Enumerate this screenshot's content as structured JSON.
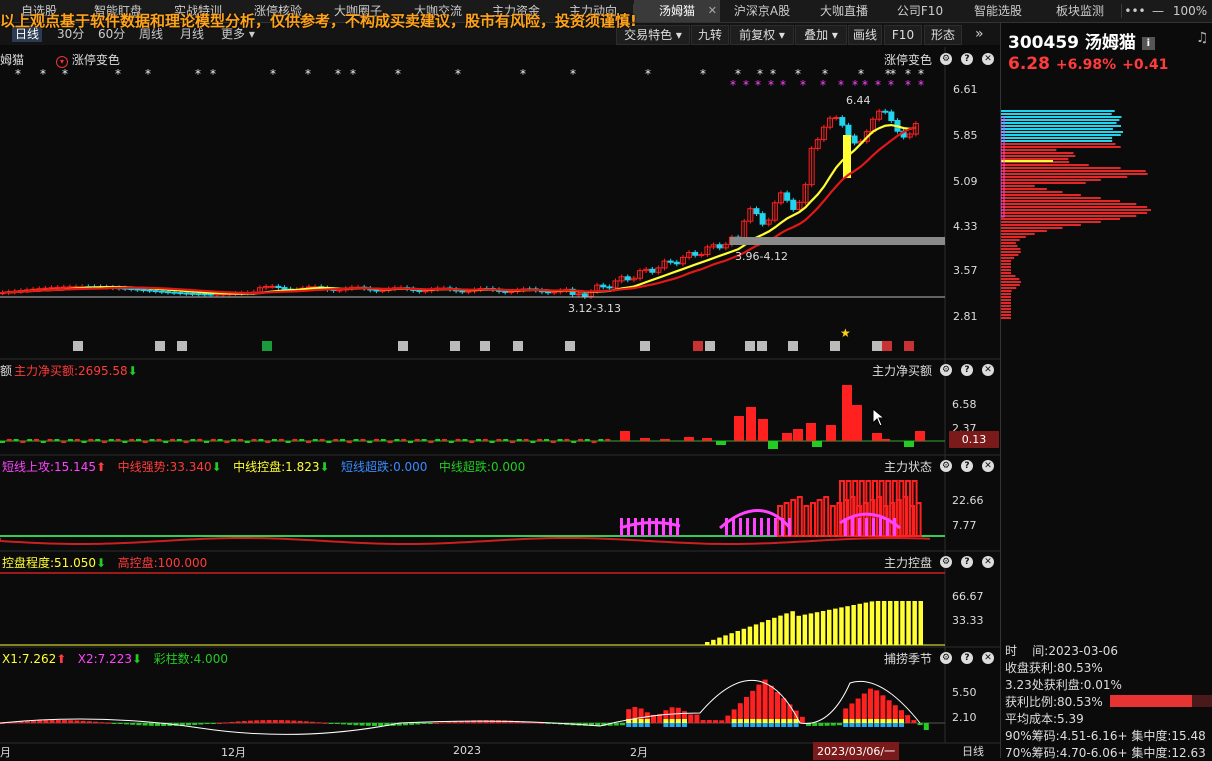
{
  "tabs": [
    {
      "label": "自选股"
    },
    {
      "label": "智能盯盘"
    },
    {
      "label": "实战特训"
    },
    {
      "label": "涨停核验"
    },
    {
      "label": "大咖圈子"
    },
    {
      "label": "大咖交流"
    },
    {
      "label": "主力资金"
    },
    {
      "label": "主力动向"
    },
    {
      "label": "汤姆猫"
    },
    {
      "label": "沪深京A股"
    },
    {
      "label": "大咖直播"
    },
    {
      "label": "公司F10"
    },
    {
      "label": "智能选股"
    },
    {
      "label": "板块监测"
    }
  ],
  "window": {
    "more": "•••",
    "minimize": "—",
    "zoom": "100%"
  },
  "disclaimer": "以上观点基于软件数据和理论模型分析，仅供参考，不构成买卖建议，股市有风险，投资须谨慎!",
  "periods": [
    "日线",
    "30分",
    "60分",
    "周线",
    "月线",
    "更多"
  ],
  "toolbar": [
    "交易特色",
    "九转",
    "前复权",
    "叠加",
    "画线",
    "F10",
    "形态"
  ],
  "main": {
    "stock_name": "姆猫",
    "overlay_label": "涨停变色",
    "right_label": "涨停变色",
    "price_labels": [
      "6.61",
      "5.85",
      "5.09",
      "4.33",
      "3.57",
      "2.81"
    ],
    "annot_top": "6.44",
    "annot_range": "3.96-4.12",
    "annot_low": "3.12-3.13"
  },
  "panel2": {
    "title_left": "额",
    "metric": "主力净买额:2695.58",
    "title": "主力净买额",
    "labels": [
      "6.58",
      "2.37"
    ],
    "badge": "0.13"
  },
  "panel3": {
    "items": [
      "短线上攻:15.145",
      "中线强势:33.340",
      "中线控盘:1.823",
      "短线超跌:0.000",
      "中线超跌:0.000"
    ],
    "title": "主力状态",
    "labels": [
      "22.66",
      "7.77"
    ]
  },
  "panel4": {
    "items": [
      "控盘程度:51.050",
      "高控盘:100.000"
    ],
    "title": "主力控盘",
    "labels": [
      "66.67",
      "33.33"
    ]
  },
  "panel5": {
    "items": [
      "X1:7.262",
      "X2:7.223",
      "彩柱数:4.000"
    ],
    "title": "捕捞季节",
    "labels": [
      "5.50",
      "2.10"
    ]
  },
  "xaxis": {
    "labels": [
      "月",
      "12月",
      "2023",
      "2月"
    ],
    "current": "2023/03/06/一",
    "period": "日线"
  },
  "quote": {
    "code": "300459",
    "name": "汤姆猫",
    "price": "6.28",
    "pct": "+6.98%",
    "chg": "+0.41"
  },
  "chips": [
    {
      "k": "时",
      "v": "间:2023-03-06"
    },
    {
      "k": "收盘获利:",
      "v": "80.53%"
    },
    {
      "k": "3.23处获利盘:",
      "v": "0.01%"
    },
    {
      "k": "获利比例:",
      "v": "80.53%"
    },
    {
      "k": "平均成本:",
      "v": "5.39"
    },
    {
      "k": "90%筹码:4.51-6.16+",
      "v": "集中度:15.48"
    },
    {
      "k": "70%筹码:4.70-6.06+",
      "v": "集中度:12.63"
    }
  ],
  "colors": {
    "up": "#ff2020",
    "down": "#22d3ee",
    "yellow": "#ffff33",
    "magenta": "#ff44ff",
    "green": "#22cc22",
    "accent_orange": "#ffa31a"
  }
}
